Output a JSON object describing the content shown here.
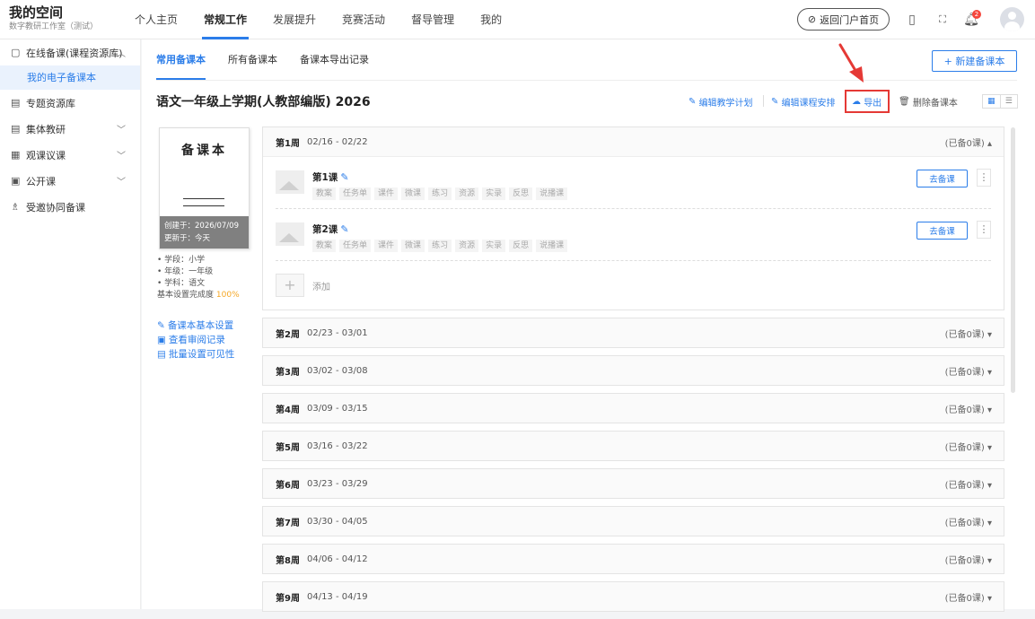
{
  "app": {
    "title": "我的空间",
    "subtitle": "数字教研工作室（测试）"
  },
  "nav": [
    "个人主页",
    "常规工作",
    "发展提升",
    "竞赛活动",
    "督导管理",
    "我的"
  ],
  "nav_active": 1,
  "header": {
    "back_label": "返回门户首页",
    "notification_count": "2"
  },
  "sidebar": {
    "items": [
      {
        "label": "在线备课(课程资源库)",
        "icon": "file-icon",
        "chevron": "^"
      },
      {
        "label": "我的电子备课本",
        "sub": true
      },
      {
        "label": "专题资源库",
        "icon": "calendar-icon"
      },
      {
        "label": "集体教研",
        "icon": "doc-icon",
        "chevron": "v"
      },
      {
        "label": "观课议课",
        "icon": "board-icon",
        "chevron": "v"
      },
      {
        "label": "公开课",
        "icon": "screen-icon",
        "chevron": "v"
      },
      {
        "label": "受邀协同备课",
        "icon": "group-icon"
      }
    ]
  },
  "tabs": [
    "常用备课本",
    "所有备课本",
    "备课本导出记录"
  ],
  "new_button": "+ 新建备课本",
  "book": {
    "title": "语文一年级上学期(人教部编版) 2026",
    "cover_title": "备课本",
    "created": "创建于：2026/07/09",
    "updated": "更新于：今天",
    "info": [
      "学段：小学",
      "年级：一年级",
      "学科：语文"
    ],
    "completion_label": "基本设置完成度",
    "completion_value": "100%"
  },
  "actions": {
    "edit_plan": "编辑教学计划",
    "edit_schedule": "编辑课程安排",
    "export": "导出",
    "delete": "删除备课本"
  },
  "links": [
    "备课本基本设置",
    "查看审阅记录",
    "批量设置可见性"
  ],
  "weeks": [
    {
      "num": "第1周",
      "range": "02/16 - 02/22",
      "status": "(已备0课)",
      "expanded": true,
      "lessons": [
        {
          "name": "第1课",
          "button": "去备课"
        },
        {
          "name": "第2课",
          "button": "去备课"
        }
      ],
      "add_label": "添加"
    },
    {
      "num": "第2周",
      "range": "02/23 - 03/01",
      "status": "(已备0课)"
    },
    {
      "num": "第3周",
      "range": "03/02 - 03/08",
      "status": "(已备0课)"
    },
    {
      "num": "第4周",
      "range": "03/09 - 03/15",
      "status": "(已备0课)"
    },
    {
      "num": "第5周",
      "range": "03/16 - 03/22",
      "status": "(已备0课)"
    },
    {
      "num": "第6周",
      "range": "03/23 - 03/29",
      "status": "(已备0课)"
    },
    {
      "num": "第7周",
      "range": "03/30 - 04/05",
      "status": "(已备0课)"
    },
    {
      "num": "第8周",
      "range": "04/06 - 04/12",
      "status": "(已备0课)"
    },
    {
      "num": "第9周",
      "range": "04/13 - 04/19",
      "status": "(已备0课)"
    }
  ],
  "lesson_tags": [
    "教案",
    "任务单",
    "课件",
    "微课",
    "练习",
    "资源",
    "实录",
    "反思",
    "说播课"
  ],
  "colors": {
    "accent": "#2b7de9",
    "highlight": "#e53935",
    "completion": "#f5a623"
  }
}
